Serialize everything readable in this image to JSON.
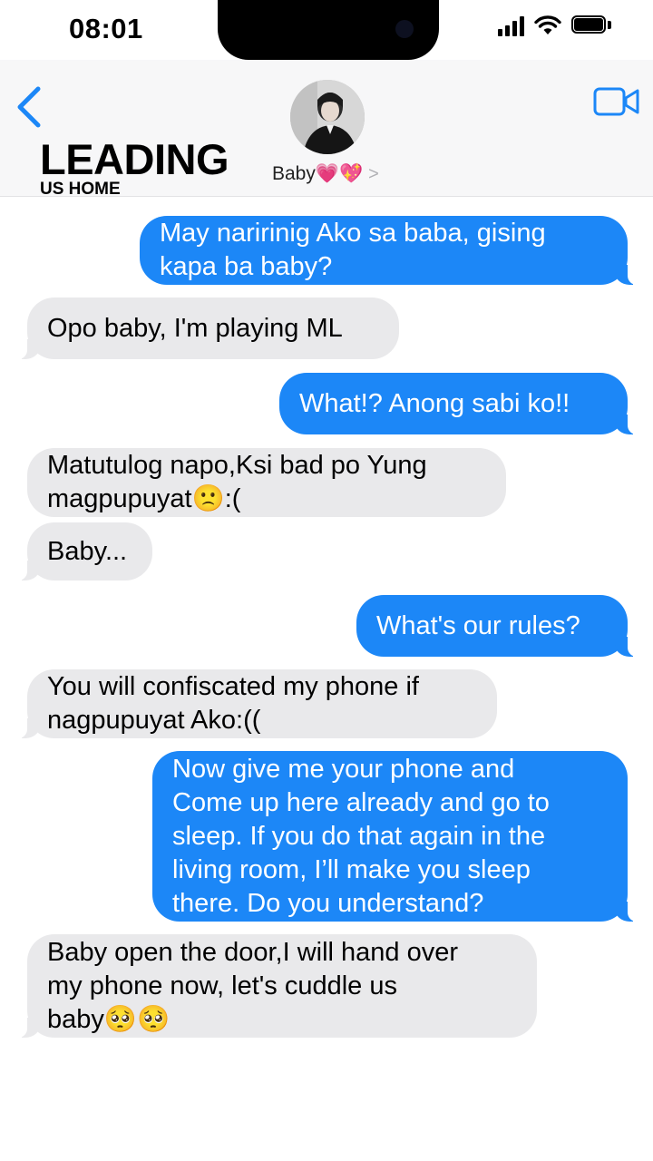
{
  "status": {
    "time": "08:01"
  },
  "header": {
    "contact_name": "Baby💗💖",
    "chevron": ">",
    "watermark_big": "LEADING",
    "watermark_small": "US HOME"
  },
  "messages": [
    {
      "from": "me",
      "text": "May naririnig Ako sa baba, gising\nkapa ba baby?"
    },
    {
      "from": "them",
      "text": "Opo baby, I'm playing ML"
    },
    {
      "from": "me",
      "text": "What!? Anong sabi ko!!"
    },
    {
      "from": "them",
      "text": "Matutulog napo,Ksi bad po Yung\nmagpupuyat🙁:("
    },
    {
      "from": "them",
      "text": "Baby..."
    },
    {
      "from": "me",
      "text": "What's our rules?"
    },
    {
      "from": "them",
      "text": "You will confiscated my phone if\nnagpupuyat Ako:(("
    },
    {
      "from": "me",
      "text": "Now give me your phone and\nCome up here already and go to\nsleep. If you do that again in the\nliving room, I’ll make you sleep\nthere. Do you understand?"
    },
    {
      "from": "them",
      "text": "Baby open the door,I will hand over\nmy phone now, let's cuddle us\nbaby🥺🥺"
    }
  ],
  "colors": {
    "sent_bubble": "#1c87f7",
    "received_bubble": "#e9e9eb",
    "accent": "#1c87f7"
  }
}
